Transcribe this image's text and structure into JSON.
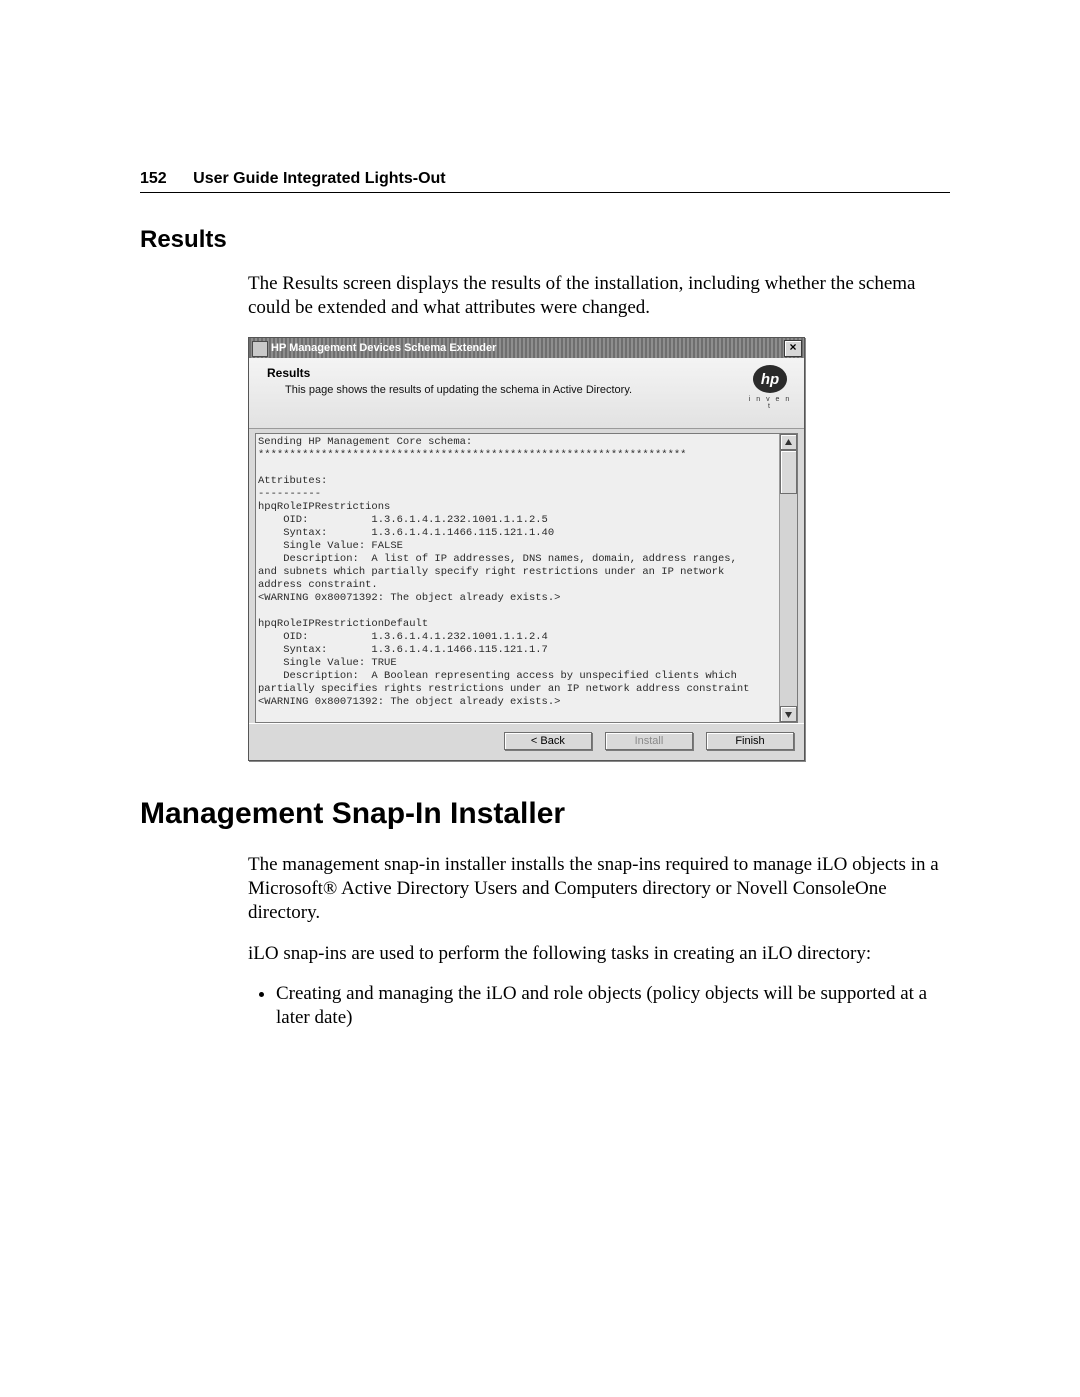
{
  "running_head": {
    "page_number": "152",
    "title": "User Guide Integrated Lights-Out"
  },
  "sections": {
    "results": {
      "heading": "Results",
      "para": "The Results screen displays the results of the installation, including whether the schema could be extended and what attributes were changed."
    },
    "snapin": {
      "heading": "Management Snap-In Installer",
      "para1": "The management snap-in installer installs the snap-ins required to manage iLO objects in a Microsoft® Active Directory Users and Computers directory or Novell ConsoleOne directory.",
      "para2": "iLO snap-ins are used to perform the following tasks in creating an iLO directory:",
      "bullet1": "Creating and managing the iLO and role objects (policy objects will be supported at a later date)"
    }
  },
  "dialog": {
    "title": "HP Management Devices Schema Extender",
    "close_glyph": "×",
    "header_title": "Results",
    "header_sub": "This page shows the results of updating the schema in Active Directory.",
    "logo_tag": "i n v e n t",
    "log_text": "Sending HP Management Core schema:\n********************************************************************\n\nAttributes:\n----------\nhpqRoleIPRestrictions\n    OID:          1.3.6.1.4.1.232.1001.1.1.2.5\n    Syntax:       1.3.6.1.4.1.1466.115.121.1.40\n    Single Value: FALSE\n    Description:  A list of IP addresses, DNS names, domain, address ranges,\nand subnets which partially specify right restrictions under an IP network\naddress constraint.\n<WARNING 0x80071392: The object already exists.>\n\nhpqRoleIPRestrictionDefault\n    OID:          1.3.6.1.4.1.232.1001.1.1.2.4\n    Syntax:       1.3.6.1.4.1.1466.115.121.1.7\n    Single Value: TRUE\n    Description:  A Boolean representing access by unspecified clients which\npartially specifies rights restrictions under an IP network address constraint\n<WARNING 0x80071392: The object already exists.>",
    "buttons": {
      "back": "< Back",
      "install": "Install",
      "finish": "Finish"
    }
  }
}
